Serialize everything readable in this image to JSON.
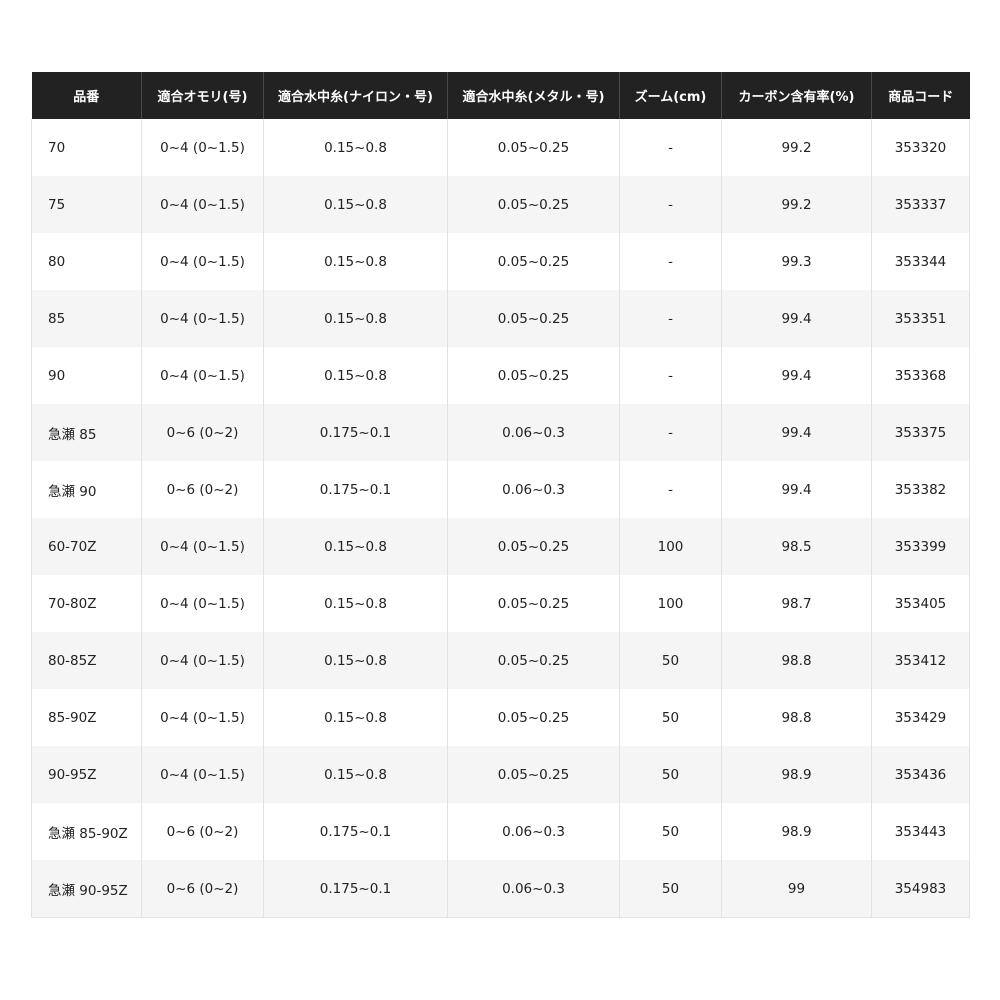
{
  "table": {
    "headers": [
      "品番",
      "適合オモリ(号)",
      "適合水中糸(ナイロン・号)",
      "適合水中糸(メタル・号)",
      "ズーム(cm)",
      "カーボン含有率(%)",
      "商品コード"
    ],
    "rows": [
      [
        "70",
        "0~4 (0~1.5)",
        "0.15~0.8",
        "0.05~0.25",
        "-",
        "99.2",
        "353320"
      ],
      [
        "75",
        "0~4 (0~1.5)",
        "0.15~0.8",
        "0.05~0.25",
        "-",
        "99.2",
        "353337"
      ],
      [
        "80",
        "0~4 (0~1.5)",
        "0.15~0.8",
        "0.05~0.25",
        "-",
        "99.3",
        "353344"
      ],
      [
        "85",
        "0~4 (0~1.5)",
        "0.15~0.8",
        "0.05~0.25",
        "-",
        "99.4",
        "353351"
      ],
      [
        "90",
        "0~4 (0~1.5)",
        "0.15~0.8",
        "0.05~0.25",
        "-",
        "99.4",
        "353368"
      ],
      [
        "急瀬 85",
        "0~6 (0~2)",
        "0.175~0.1",
        "0.06~0.3",
        "-",
        "99.4",
        "353375"
      ],
      [
        "急瀬 90",
        "0~6 (0~2)",
        "0.175~0.1",
        "0.06~0.3",
        "-",
        "99.4",
        "353382"
      ],
      [
        "60-70Z",
        "0~4 (0~1.5)",
        "0.15~0.8",
        "0.05~0.25",
        "100",
        "98.5",
        "353399"
      ],
      [
        "70-80Z",
        "0~4 (0~1.5)",
        "0.15~0.8",
        "0.05~0.25",
        "100",
        "98.7",
        "353405"
      ],
      [
        "80-85Z",
        "0~4 (0~1.5)",
        "0.15~0.8",
        "0.05~0.25",
        "50",
        "98.8",
        "353412"
      ],
      [
        "85-90Z",
        "0~4 (0~1.5)",
        "0.15~0.8",
        "0.05~0.25",
        "50",
        "98.8",
        "353429"
      ],
      [
        "90-95Z",
        "0~4 (0~1.5)",
        "0.15~0.8",
        "0.05~0.25",
        "50",
        "98.9",
        "353436"
      ],
      [
        "急瀬 85-90Z",
        "0~6 (0~2)",
        "0.175~0.1",
        "0.06~0.3",
        "50",
        "98.9",
        "353443"
      ],
      [
        "急瀬 90-95Z",
        "0~6 (0~2)",
        "0.175~0.1",
        "0.06~0.3",
        "50",
        "99",
        "354983"
      ]
    ]
  },
  "colors": {
    "header_background": "#222222",
    "header_text": "#ffffff",
    "stripe_row": "#f5f5f5",
    "border": "#e2e2e2"
  }
}
